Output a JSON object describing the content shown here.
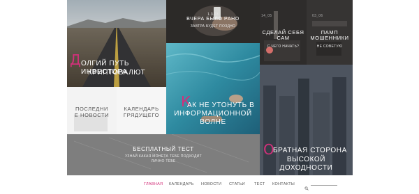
{
  "colors": {
    "accent": "#d2307a",
    "nav_text": "#555555"
  },
  "tiles": {
    "road": {
      "num": "30",
      "cap": "Д",
      "title1": "олгий путь инвестора",
      "title2": "Криптовалют"
    },
    "hand_phone": {
      "date": "1.3.03",
      "title": "Вчера было рано",
      "subtitle": "Завтра будет поздно"
    },
    "dark_a": {
      "num": "14_05",
      "title1": "Сделай себя",
      "title2": "сам",
      "subtitle": "С чего начать?"
    },
    "dark_b": {
      "num": "03_06",
      "title1": "Памп",
      "title2": "мошенники",
      "subtitle": "Не советую"
    },
    "news": {
      "line1": "Последни",
      "line2": "е новости"
    },
    "calendar": {
      "line1": "Календарь",
      "line2": "грядущего"
    },
    "water": {
      "cap": "К",
      "title1": "ак не утонуть в",
      "title2": "информационной",
      "title3": "волне"
    },
    "city": {
      "cap": "О",
      "title1": "братная сторона",
      "title2": "высокой доходности"
    },
    "test": {
      "title": "Бесплатный тест",
      "subtitle1": "Узнай какая монета тебе подходит",
      "subtitle2": "Личнo тебе"
    }
  },
  "nav": {
    "items": [
      "Главная",
      "Календарь",
      "Новости",
      "Статьи",
      "Тест",
      "Контакты"
    ],
    "search_icon": "search-icon"
  }
}
